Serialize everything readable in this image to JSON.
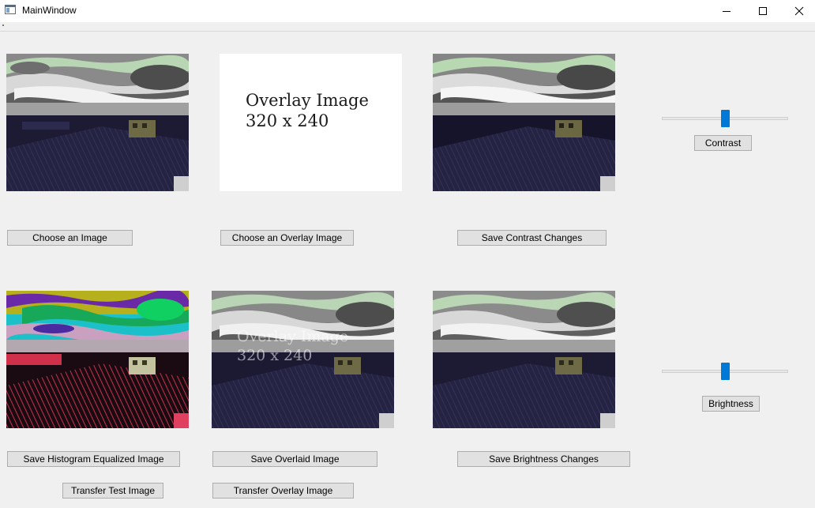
{
  "window": {
    "title": "MainWindow"
  },
  "images": {
    "original": {
      "name": "original image"
    },
    "overlay": {
      "line1": "Overlay Image",
      "line2": "320 x 240"
    },
    "contrast": {
      "name": "contrast image"
    },
    "histogram": {
      "name": "histogram equalized image"
    },
    "overlaid": {
      "line1": "Overlay Image",
      "line2": "320 x 240"
    },
    "brightness": {
      "name": "brightness image"
    }
  },
  "buttons": {
    "choose_image": "Choose an Image",
    "choose_overlay": "Choose an Overlay Image",
    "save_contrast": "Save Contrast Changes",
    "save_histogram": "Save Histogram Equalized Image",
    "save_overlaid": "Save Overlaid Image",
    "save_brightness": "Save Brightness Changes",
    "transfer_test": "Transfer Test Image",
    "transfer_overlay": "Transfer Overlay Image",
    "contrast": "Contrast",
    "brightness": "Brightness"
  },
  "sliders": {
    "contrast": {
      "value_fraction": 0.5
    },
    "brightness": {
      "value_fraction": 0.5
    }
  },
  "colors": {
    "accent": "#0078d7",
    "button_bg": "#e1e1e1",
    "window_bg": "#f0f0f0"
  },
  "icons": {
    "app": "app-window-icon",
    "minimize": "minimize-icon",
    "maximize": "maximize-icon",
    "close": "close-icon"
  }
}
